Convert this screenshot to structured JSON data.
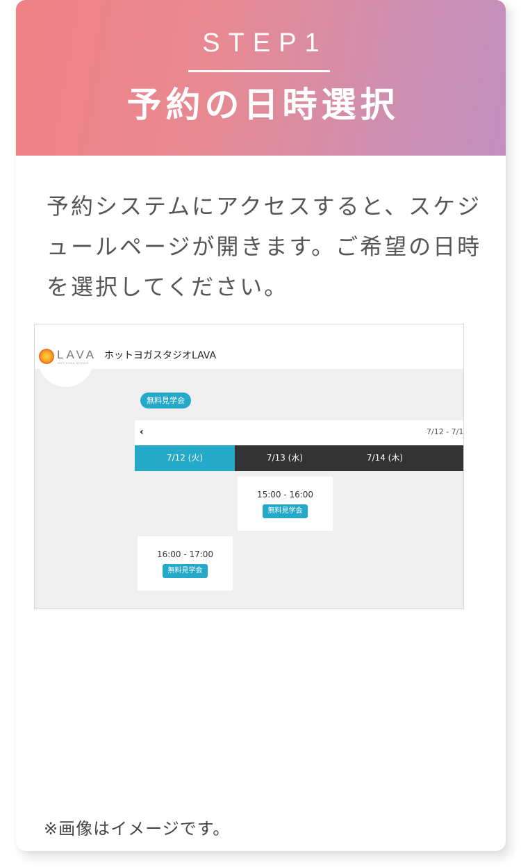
{
  "step": {
    "label": "STEP1",
    "title": "予約の日時選択",
    "description": "予約システムにアクセスすると、スケジュールページが開きます。ご希望の日時を選択してください。"
  },
  "screenshot": {
    "logo_text": "LAVA",
    "logo_subtext": "HOT YOGA STUDIO",
    "studio_name": "ホットヨガスタジオLAVA",
    "program_tag": "無料見学会",
    "prev_arrow": "‹",
    "date_range": "7/12 - 7/1",
    "days": [
      {
        "label": "7/12 (火)",
        "active": true
      },
      {
        "label": "7/13 (水)",
        "active": false
      },
      {
        "label": "7/14 (木)",
        "active": false
      }
    ],
    "slots": [
      {
        "time": "15:00 - 16:00",
        "tag": "無料見学会",
        "day_index": 1
      },
      {
        "time": "16:00 - 17:00",
        "tag": "無料見学会",
        "day_index": 0
      }
    ]
  },
  "note": "※画像はイメージです。",
  "colors": {
    "accent": "#24a9c8",
    "header_start": "#ee8185",
    "header_end": "#c18fbf",
    "day_bar": "#333333"
  }
}
